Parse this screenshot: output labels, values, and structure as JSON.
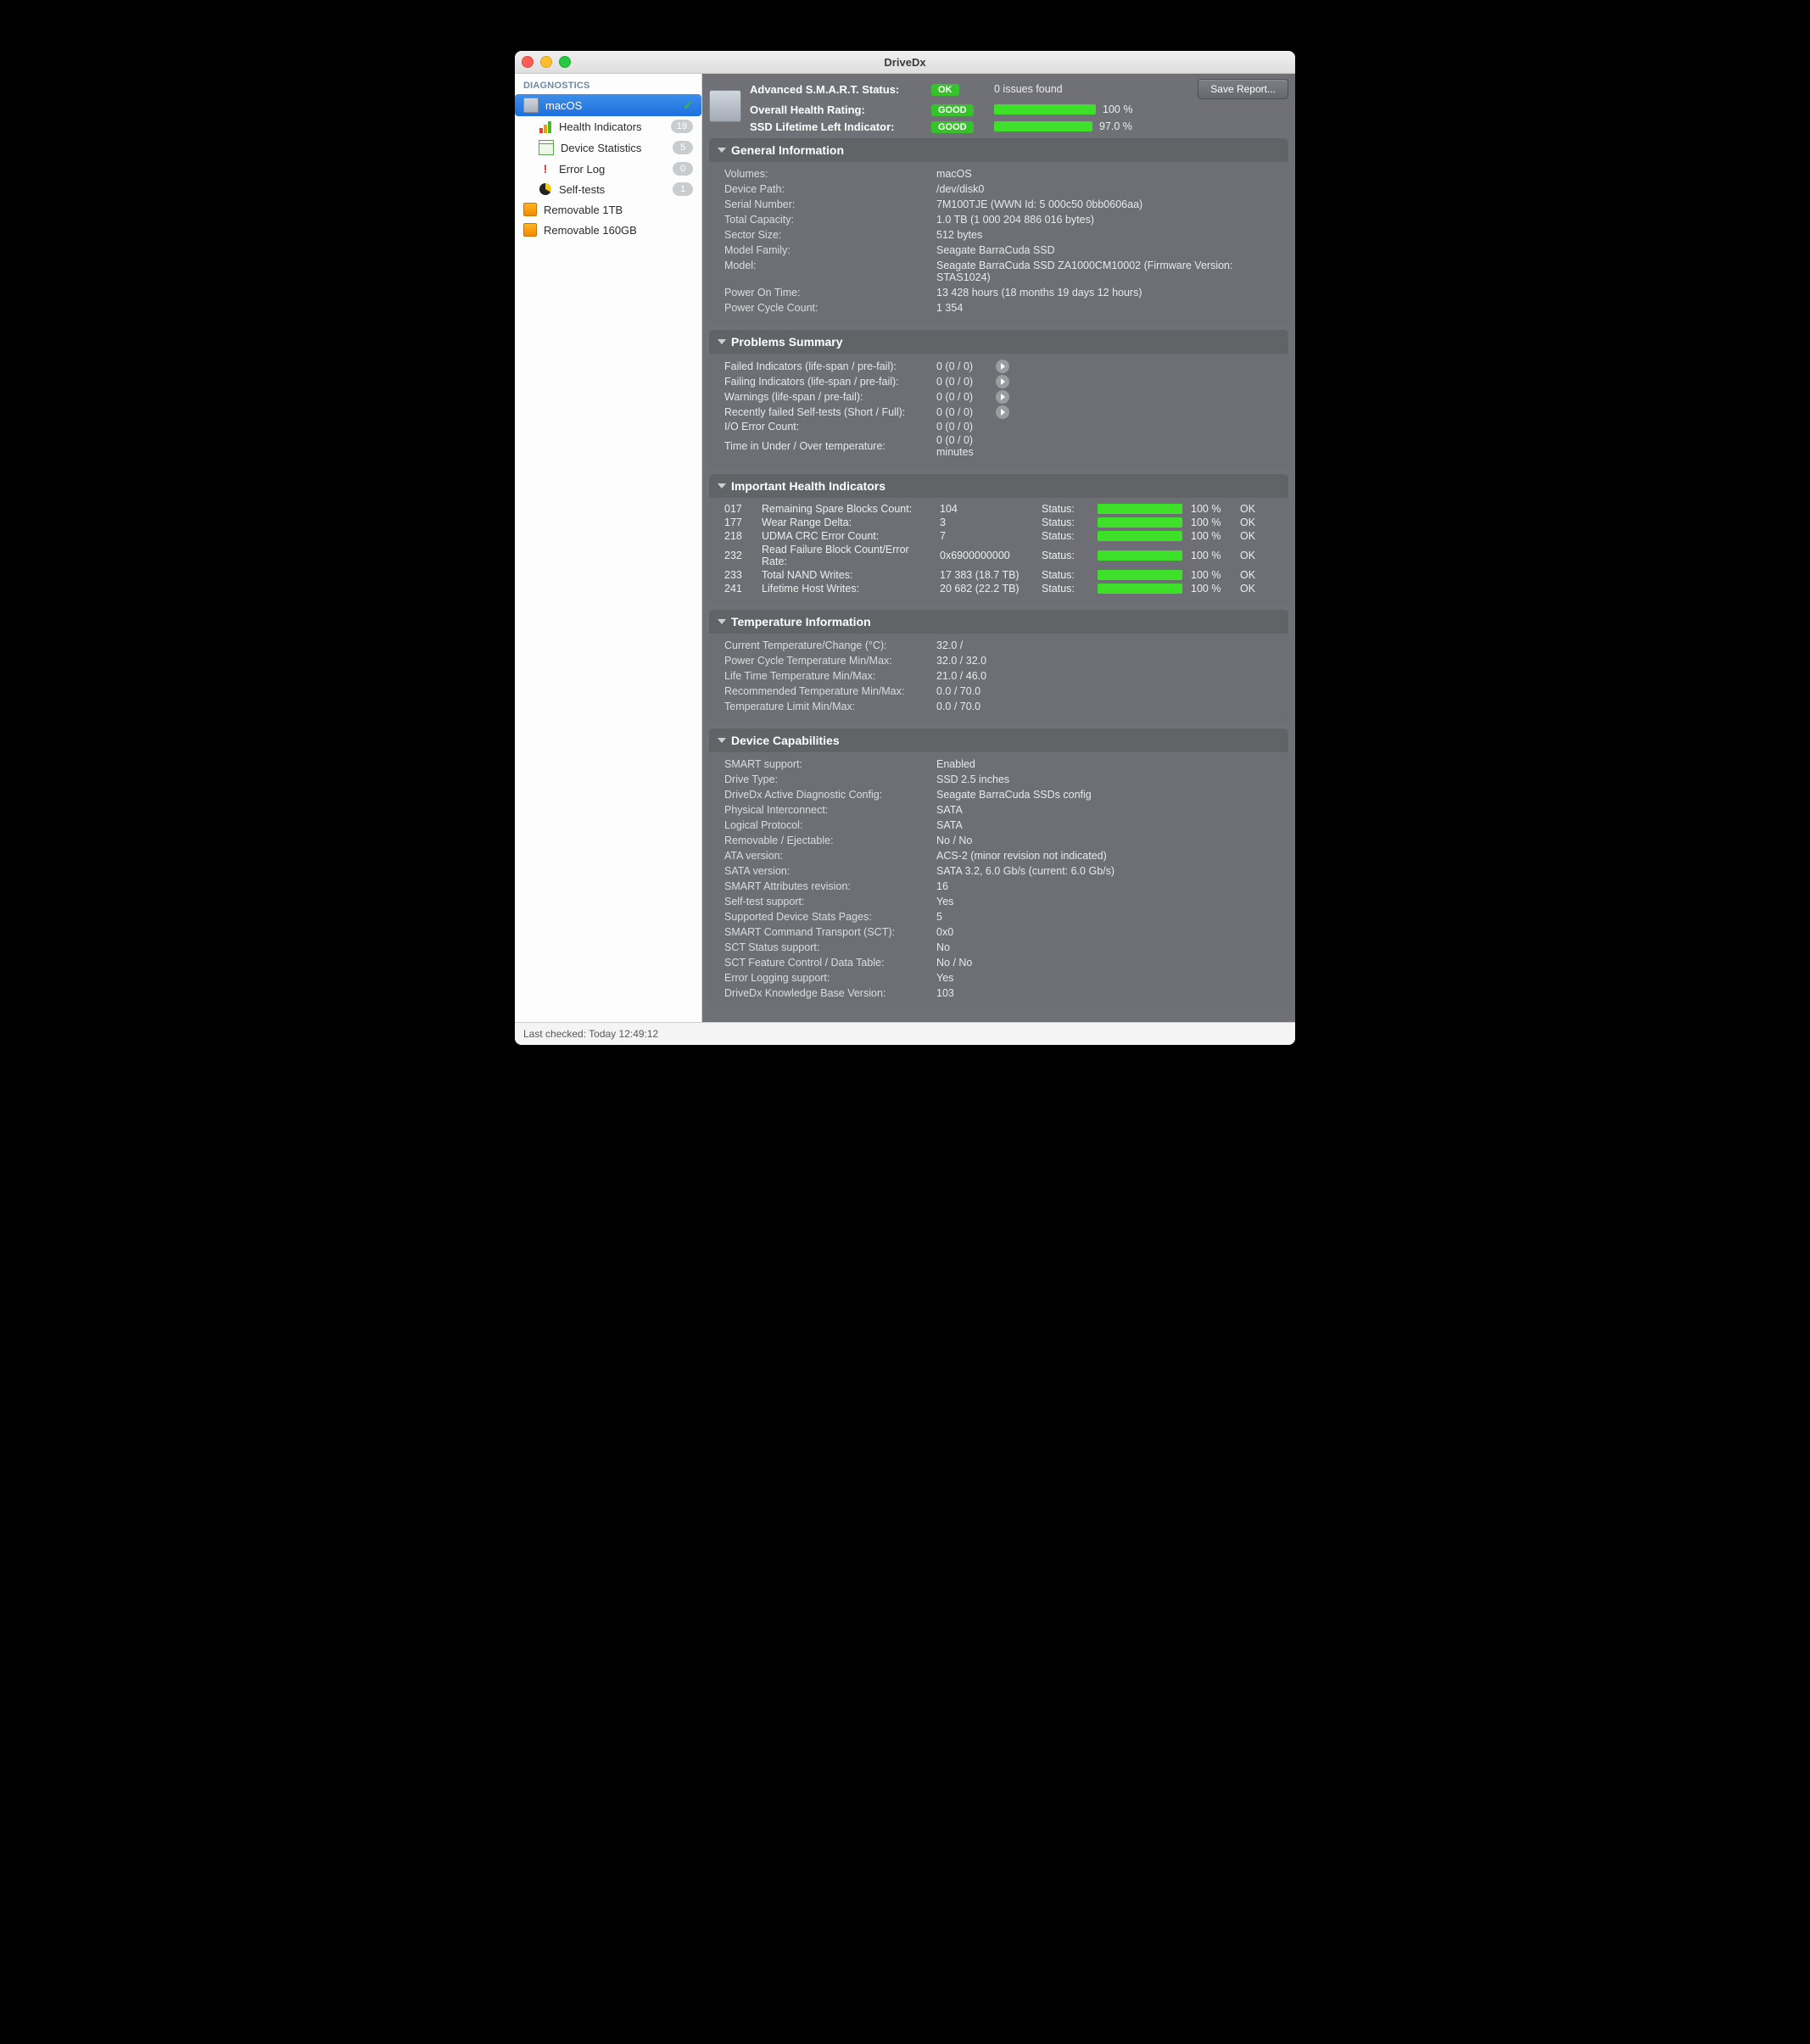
{
  "window": {
    "title": "DriveDx"
  },
  "sidebar": {
    "header": "DIAGNOSTICS",
    "drive": "macOS",
    "items": [
      {
        "label": "Health Indicators",
        "badge": "19"
      },
      {
        "label": "Device Statistics",
        "badge": "5"
      },
      {
        "label": "Error Log",
        "badge": "0"
      },
      {
        "label": "Self-tests",
        "badge": "1"
      }
    ],
    "ext1": "Removable 1TB",
    "ext2": "Removable 160GB"
  },
  "header": {
    "l1": "Advanced S.M.A.R.T. Status:",
    "l2": "Overall Health Rating:",
    "l3": "SSD Lifetime Left Indicator:",
    "p1": "OK",
    "p2": "GOOD",
    "p3": "GOOD",
    "issues": "0 issues found",
    "pct2": "100 %",
    "pct3": "97.0 %",
    "save": "Save Report..."
  },
  "gen": {
    "title": "General Information",
    "rows": [
      [
        "Volumes:",
        "macOS"
      ],
      [
        "Device Path:",
        "/dev/disk0"
      ],
      [
        "Serial Number:",
        "7M100TJE (WWN Id: 5 000c50 0bb0606aa)"
      ],
      [
        "Total Capacity:",
        "1.0 TB (1 000 204 886 016 bytes)"
      ],
      [
        "Sector Size:",
        "512 bytes"
      ],
      [
        "Model Family:",
        "Seagate BarraCuda SSD"
      ],
      [
        "Model:",
        "Seagate BarraCuda SSD ZA1000CM10002  (Firmware Version: STAS1024)"
      ],
      [
        "Power On Time:",
        "13 428 hours (18 months 19 days 12 hours)"
      ],
      [
        "Power Cycle Count:",
        "1 354"
      ]
    ]
  },
  "prob": {
    "title": "Problems Summary",
    "rows": [
      [
        "Failed Indicators (life-span / pre-fail):",
        "0 (0 / 0)",
        true
      ],
      [
        "Failing Indicators (life-span / pre-fail):",
        "0 (0 / 0)",
        true
      ],
      [
        "Warnings (life-span / pre-fail):",
        "0 (0 / 0)",
        true
      ],
      [
        "Recently failed Self-tests (Short / Full):",
        "0 (0 / 0)",
        true
      ],
      [
        "I/O Error Count:",
        "0 (0 / 0)",
        false
      ],
      [
        "Time in Under / Over temperature:",
        "0 (0 / 0)   minutes",
        false
      ]
    ]
  },
  "hi": {
    "title": "Important Health Indicators",
    "statusLabel": "Status:",
    "ok": "OK",
    "rows": [
      [
        "017",
        "Remaining Spare Blocks Count:",
        "104",
        "100 %"
      ],
      [
        "177",
        "Wear Range Delta:",
        "3",
        "100 %"
      ],
      [
        "218",
        "UDMA CRC Error Count:",
        "7",
        "100 %"
      ],
      [
        "232",
        "Read Failure Block Count/Error Rate:",
        "0x6900000000",
        "100 %"
      ],
      [
        "233",
        "Total NAND Writes:",
        "17 383 (18.7 TB)",
        "100 %"
      ],
      [
        "241",
        "Lifetime Host Writes:",
        "20 682 (22.2 TB)",
        "100 %"
      ]
    ]
  },
  "temp": {
    "title": "Temperature Information",
    "rows": [
      [
        "Current Temperature/Change (°C):",
        "32.0 /"
      ],
      [
        "Power Cycle Temperature Min/Max:",
        "32.0 / 32.0"
      ],
      [
        "Life Time Temperature Min/Max:",
        "21.0 / 46.0"
      ],
      [
        "Recommended Temperature Min/Max:",
        "0.0   / 70.0"
      ],
      [
        "Temperature Limit Min/Max:",
        "0.0   / 70.0"
      ]
    ]
  },
  "cap": {
    "title": "Device Capabilities",
    "rows": [
      [
        "SMART support:",
        "Enabled"
      ],
      [
        "Drive Type:",
        "SSD 2.5 inches"
      ],
      [
        "DriveDx Active Diagnostic Config:",
        "Seagate BarraCuda SSDs config"
      ],
      [
        "Physical Interconnect:",
        "SATA"
      ],
      [
        "Logical Protocol:",
        "SATA"
      ],
      [
        "Removable / Ejectable:",
        "No / No"
      ],
      [
        "ATA version:",
        "ACS-2 (minor revision not indicated)"
      ],
      [
        "SATA version:",
        "SATA 3.2, 6.0 Gb/s (current: 6.0 Gb/s)"
      ],
      [
        "SMART Attributes revision:",
        "16"
      ],
      [
        "Self-test support:",
        "Yes"
      ],
      [
        "Supported Device Stats Pages:",
        "5"
      ],
      [
        "SMART Command Transport (SCT):",
        "0x0"
      ],
      [
        "SCT Status support:",
        "No"
      ],
      [
        "SCT Feature Control / Data Table:",
        "No / No"
      ],
      [
        "Error Logging support:",
        "Yes"
      ],
      [
        "DriveDx Knowledge Base Version:",
        "103"
      ]
    ]
  },
  "status": "Last checked: Today 12:49:12"
}
